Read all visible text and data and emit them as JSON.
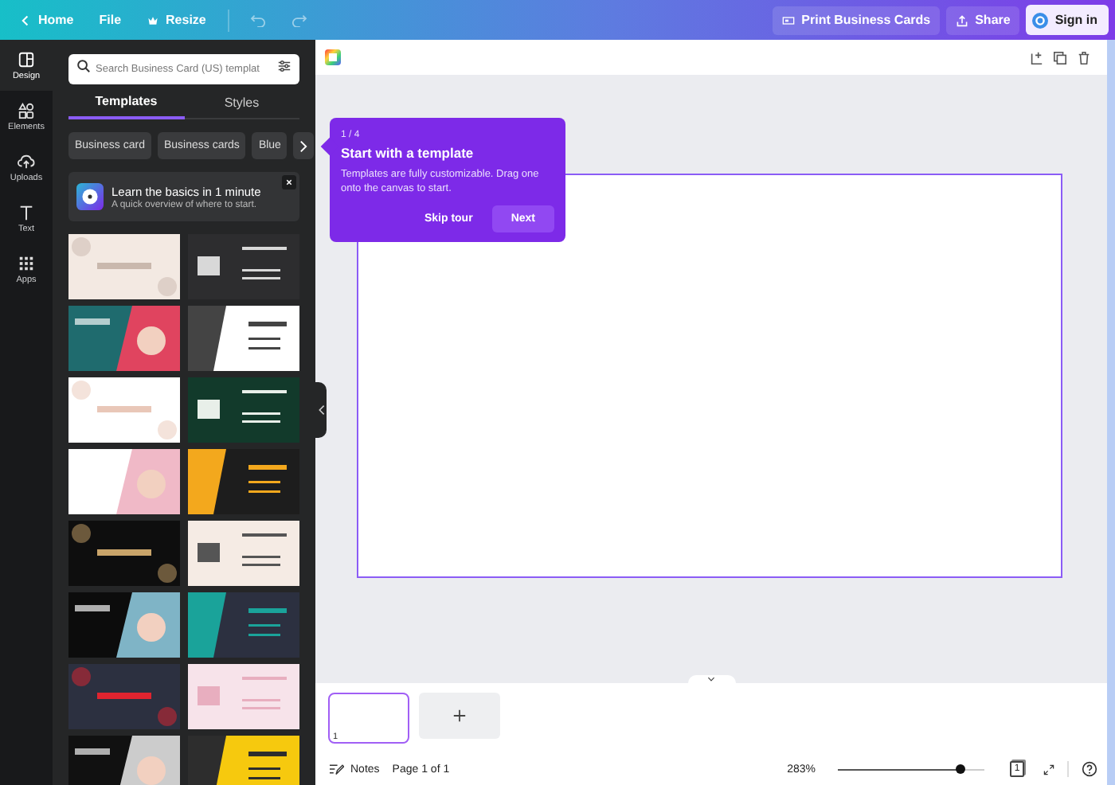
{
  "topbar": {
    "home": "Home",
    "file": "File",
    "resize": "Resize",
    "print_button": "Print Business Cards",
    "share_button": "Share",
    "sign_in_button": "Sign in"
  },
  "rail": [
    {
      "label": "Design",
      "kind": "design",
      "selected": true
    },
    {
      "label": "Elements",
      "kind": "elements",
      "selected": false
    },
    {
      "label": "Uploads",
      "kind": "uploads",
      "selected": false
    },
    {
      "label": "Text",
      "kind": "text",
      "selected": false
    },
    {
      "label": "Apps",
      "kind": "apps",
      "selected": false
    }
  ],
  "panel": {
    "search": {
      "placeholder": "Search Business Card (US) templat"
    },
    "tabs": [
      {
        "label": "Templates",
        "selected": true
      },
      {
        "label": "Styles",
        "selected": false
      }
    ],
    "chips": [
      "Business card",
      "Business cards",
      "Blue"
    ],
    "promo": {
      "title": "Learn the basics in 1 minute",
      "subtitle": "A quick overview of where to start."
    }
  },
  "tour": {
    "step": "1 / 4",
    "title": "Start with a template",
    "body": "Templates are fully customizable. Drag one onto the canvas to start.",
    "skip_button": "Skip tour",
    "next_button": "Next"
  },
  "pages": [
    {
      "number": "1",
      "selected": true
    }
  ],
  "footer": {
    "notes": "Notes",
    "page_info": "Page 1 of 1",
    "zoom": "283%",
    "zoom_slider": {
      "level": 0.84
    },
    "page_count": "1"
  }
}
